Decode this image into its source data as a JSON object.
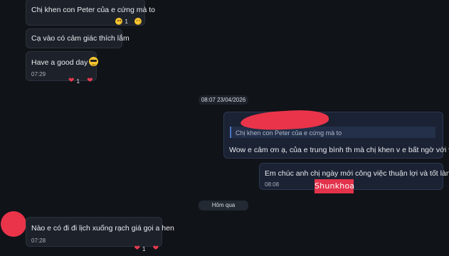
{
  "messages": [
    {
      "text": "Chị khen con Peter của e cứng mà to",
      "reaction_count": "1"
    },
    {
      "text": "Cạ vào có cảm giác thích lắm"
    },
    {
      "text": "Have a good day",
      "time": "07:29",
      "reaction_count": "1"
    },
    {
      "quote": "Chị khen con Peter của e cứng mà to",
      "text": "Wow e cảm ơn ạ, của e trung bình th mà chị khen v e bất ngờ với vui"
    },
    {
      "text": "Em chúc anh chị ngày mới công việc thuận lợi và tốt lành!!!",
      "time": "08:08"
    },
    {
      "text": "Nào e có đi đi lịch xuống rạch giá gọi a hen",
      "time": "07:28",
      "reaction_count": "1"
    }
  ],
  "separators": {
    "datetime": "08:07 23/04/2026",
    "yesterday": "Hôm qua"
  },
  "watermark": "Shunkhoa",
  "icons": {
    "laugh": "grinning-sweat-emoji-icon",
    "cool": "sunglasses-emoji-icon",
    "blush": "blushing-emoji-icon",
    "heart": "red-heart-icon"
  },
  "colors": {
    "background": "#101318",
    "incoming_bubble": "#1d222a",
    "outgoing_bubble": "#1a2233",
    "quote_bar": "#4c74c6",
    "redaction": "#e9344a"
  }
}
